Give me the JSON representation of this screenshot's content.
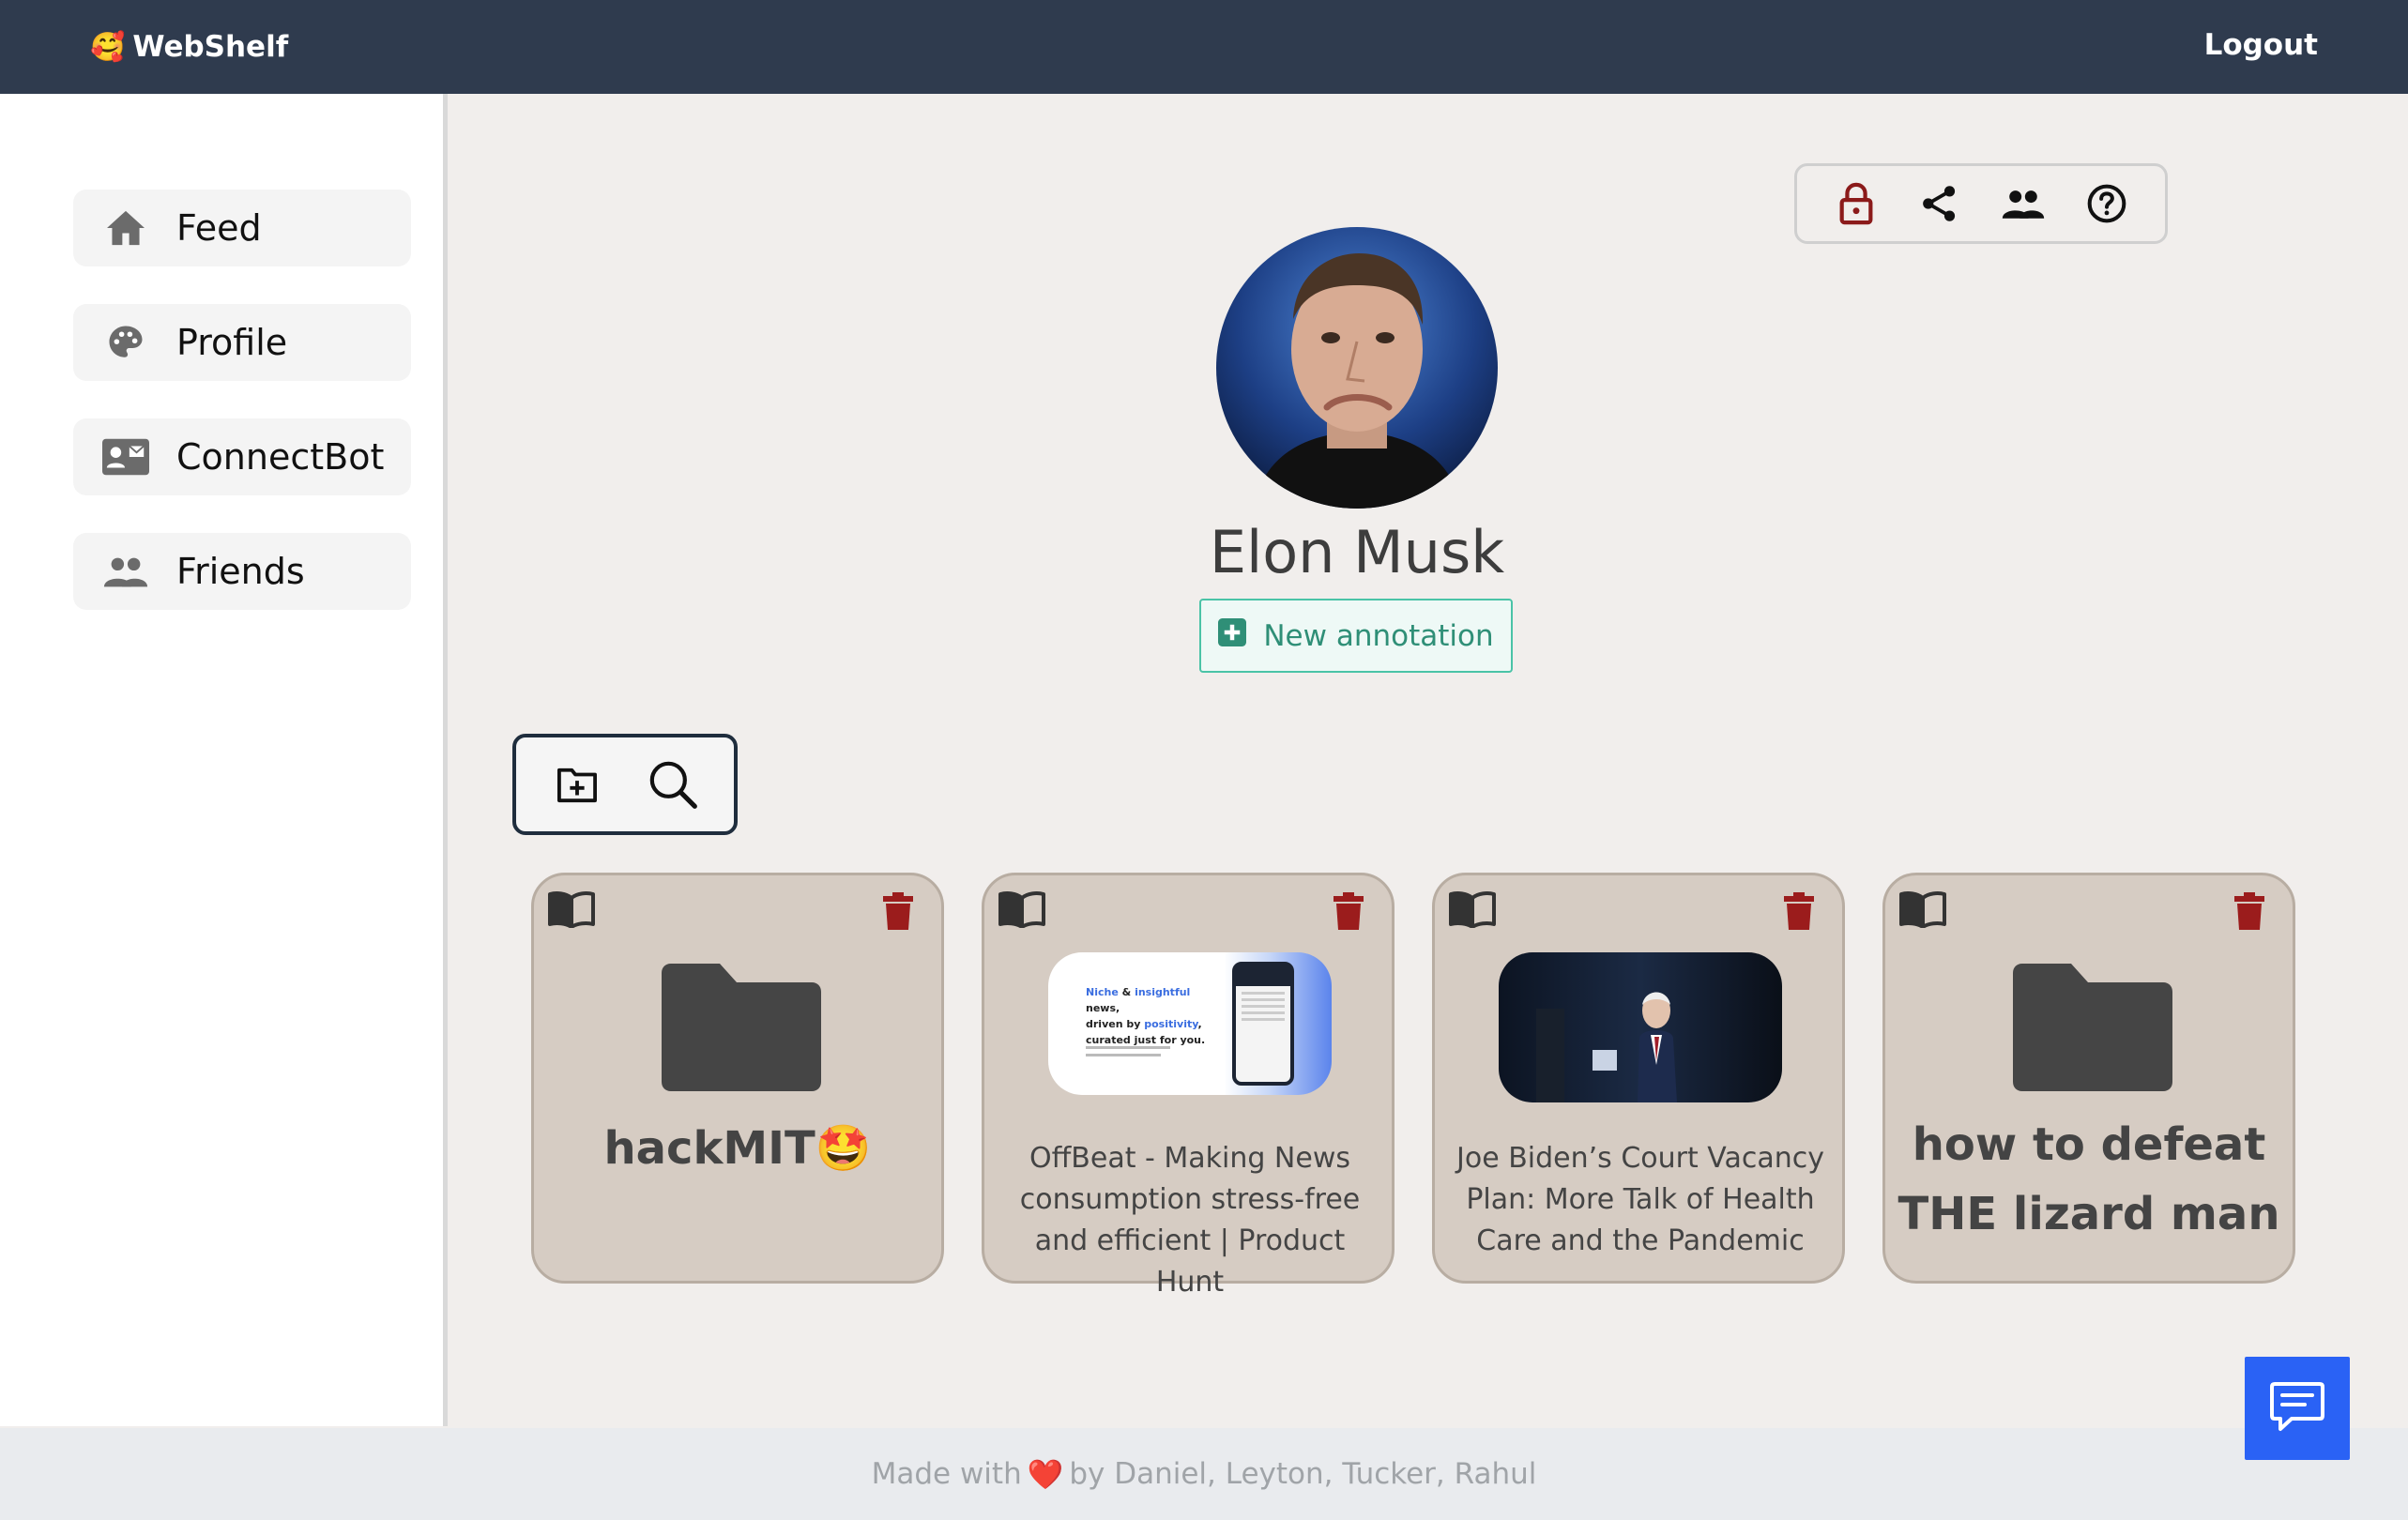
{
  "brand": {
    "emoji": "🥰",
    "name": "WebShelf"
  },
  "header": {
    "logout_label": "Logout"
  },
  "sidebar": {
    "items": [
      {
        "label": "Feed",
        "icon": "home-icon"
      },
      {
        "label": "Profile",
        "icon": "palette-icon"
      },
      {
        "label": "ConnectBot",
        "icon": "contact-card-icon"
      },
      {
        "label": "Friends",
        "icon": "people-icon"
      }
    ]
  },
  "profile": {
    "name": "Elon Musk",
    "new_annotation_label": "New annotation"
  },
  "actions": [
    "lock-icon",
    "share-icon",
    "people-icon",
    "help-icon"
  ],
  "tools": [
    "new-folder-icon",
    "search-icon"
  ],
  "cards": [
    {
      "type": "folder",
      "title": "hackMIT🤩"
    },
    {
      "type": "link",
      "title": "OffBeat - Making News consumption stress-free and efficient | Product Hunt",
      "thumb": {
        "line1a": "Niche",
        "line1b": " & ",
        "line1c": "insightful",
        "line1d": " news,",
        "line2a": "driven by ",
        "line2b": "positivity",
        "line2c": ",",
        "line3": "curated just for you."
      }
    },
    {
      "type": "link",
      "title": "Joe Biden’s Court Vacancy Plan: More Talk of Health Care and the Pandemic"
    },
    {
      "type": "folder",
      "title": "how to defeat THE lizard man"
    }
  ],
  "footer": {
    "prefix": "Made with",
    "heart": "❤️",
    "suffix": "by Daniel, Leyton, Tucker, Rahul"
  },
  "colors": {
    "topbar": "#2f3b4e",
    "accent_green": "#2f8f77",
    "chat_blue": "#2a62f5",
    "trash_red": "#9b1c1c",
    "lock_red": "#8b1a1a"
  }
}
